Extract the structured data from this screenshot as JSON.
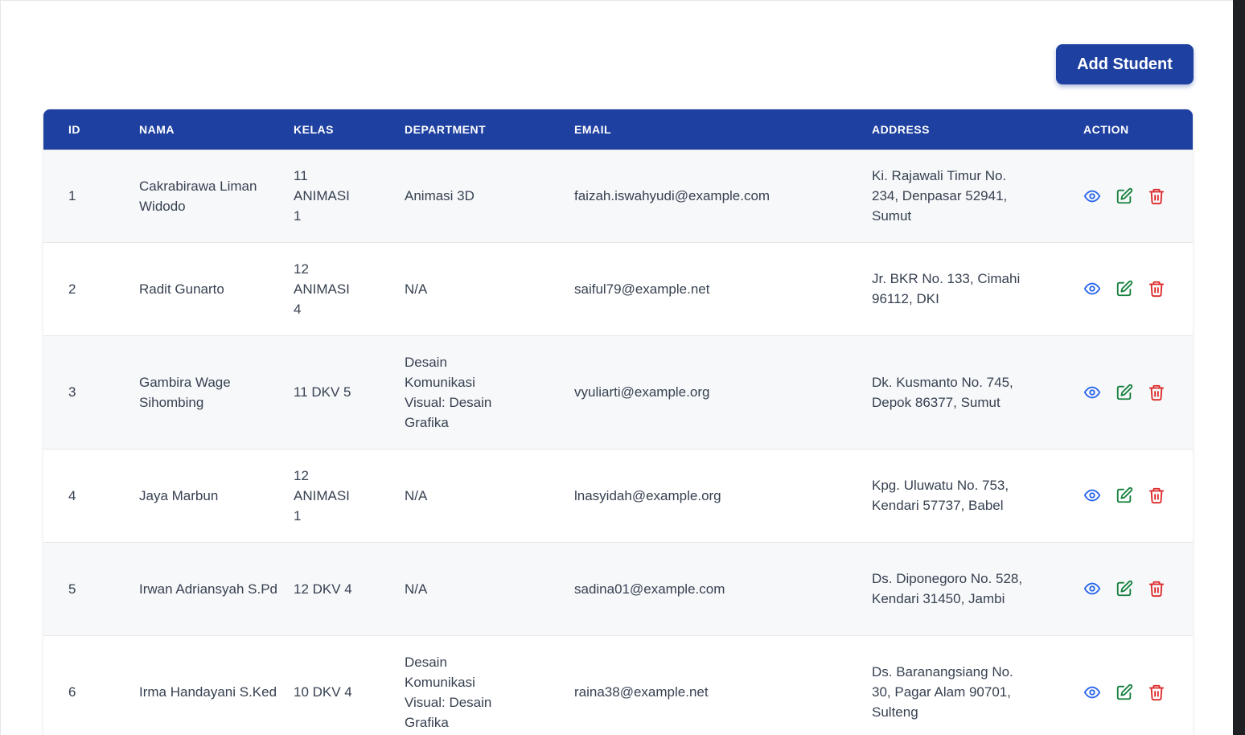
{
  "toolbar": {
    "add_label": "Add Student"
  },
  "table": {
    "headers": {
      "id": "ID",
      "nama": "NAMA",
      "kelas": "KELAS",
      "department": "DEPARTMENT",
      "email": "EMAIL",
      "address": "ADDRESS",
      "action": "ACTION"
    },
    "rows": [
      {
        "id": "1",
        "nama": "Cakrabirawa Liman Widodo",
        "kelas": "11 ANIMASI 1",
        "department": "Animasi 3D",
        "email": "faizah.iswahyudi@example.com",
        "address": "Ki. Rajawali Timur No. 234, Denpasar 52941, Sumut"
      },
      {
        "id": "2",
        "nama": "Radit Gunarto",
        "kelas": "12 ANIMASI 4",
        "department": "N/A",
        "email": "saiful79@example.net",
        "address": "Jr. BKR No. 133, Cimahi 96112, DKI"
      },
      {
        "id": "3",
        "nama": "Gambira Wage Sihombing",
        "kelas": "11 DKV 5",
        "department": "Desain Komunikasi Visual: Desain Grafika",
        "email": "vyuliarti@example.org",
        "address": "Dk. Kusmanto No. 745, Depok 86377, Sumut"
      },
      {
        "id": "4",
        "nama": "Jaya Marbun",
        "kelas": "12 ANIMASI 1",
        "department": "N/A",
        "email": "lnasyidah@example.org",
        "address": "Kpg. Uluwatu No. 753, Kendari 57737, Babel"
      },
      {
        "id": "5",
        "nama": "Irwan Adriansyah S.Pd",
        "kelas": "12 DKV 4",
        "department": "N/A",
        "email": "sadina01@example.com",
        "address": "Ds. Diponegoro No. 528, Kendari 31450, Jambi"
      },
      {
        "id": "6",
        "nama": "Irma Handayani S.Ked",
        "kelas": "10 DKV 4",
        "department": "Desain Komunikasi Visual: Desain Grafika",
        "email": "raina38@example.net",
        "address": "Ds. Baranangsiang No. 30, Pagar Alam 90701, Sulteng"
      }
    ],
    "action_icons": [
      "eye-icon",
      "edit-icon",
      "trash-icon"
    ]
  },
  "colors": {
    "primary": "#1e40a0",
    "view": "#2563eb",
    "edit": "#15803d",
    "delete": "#dc2626"
  }
}
